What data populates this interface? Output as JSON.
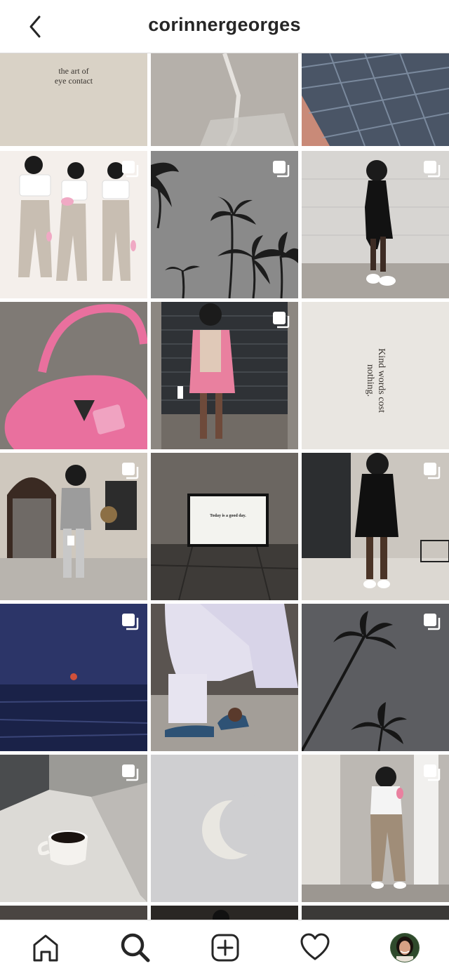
{
  "header": {
    "title": "corinnergeorges",
    "back_icon": "chevron-left-icon"
  },
  "grid": {
    "posts": [
      {
        "id": "post-1",
        "desc": "paper with text",
        "overlay_text": "the art of\neye contact",
        "multi": false
      },
      {
        "id": "post-2",
        "desc": "water pouring into glass",
        "multi": false
      },
      {
        "id": "post-3",
        "desc": "pool tiles under water",
        "multi": false
      },
      {
        "id": "post-4",
        "desc": "three outfit poses",
        "multi": true
      },
      {
        "id": "post-5",
        "desc": "palm trees grey sky",
        "multi": true
      },
      {
        "id": "post-6",
        "desc": "woman in black outfit",
        "multi": true
      },
      {
        "id": "post-7",
        "desc": "pink handbag",
        "multi": false
      },
      {
        "id": "post-8",
        "desc": "woman in pink blazer",
        "multi": true
      },
      {
        "id": "post-9",
        "desc": "paper with text",
        "overlay_text": "Kind words cost nothing.",
        "multi": false
      },
      {
        "id": "post-10",
        "desc": "woman in grey suit",
        "multi": true
      },
      {
        "id": "post-11",
        "desc": "framed sign",
        "overlay_text": "Today is a good day.",
        "multi": false
      },
      {
        "id": "post-12",
        "desc": "woman in black dress",
        "multi": true
      },
      {
        "id": "post-13",
        "desc": "ocean dusk",
        "multi": true
      },
      {
        "id": "post-14",
        "desc": "lavender pants shoes",
        "multi": false
      },
      {
        "id": "post-15",
        "desc": "single palm tree",
        "multi": true
      },
      {
        "id": "post-16",
        "desc": "coffee cup on sill",
        "multi": true
      },
      {
        "id": "post-17",
        "desc": "crescent moon",
        "multi": false
      },
      {
        "id": "post-18",
        "desc": "woman in khaki pants",
        "multi": true
      }
    ]
  },
  "nav": {
    "items": [
      {
        "name": "home",
        "icon": "home-icon"
      },
      {
        "name": "search",
        "icon": "search-icon",
        "active": true
      },
      {
        "name": "new-post",
        "icon": "plus-square-icon"
      },
      {
        "name": "activity",
        "icon": "heart-icon"
      },
      {
        "name": "profile",
        "icon": "avatar"
      }
    ]
  },
  "colors": {
    "border": "#dbdbdb",
    "text": "#262626",
    "pink": "#e9709e"
  }
}
